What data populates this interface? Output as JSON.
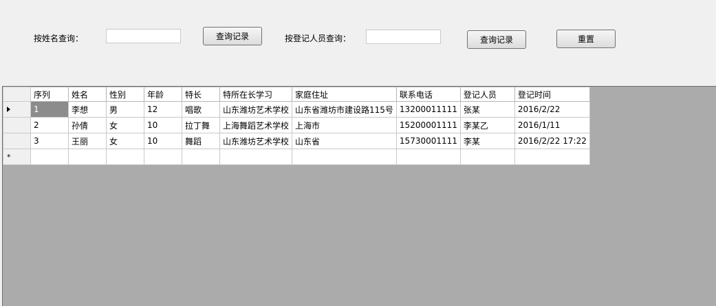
{
  "search": {
    "name_label": "按姓名查询：",
    "name_value": "",
    "name_button": "查询记录",
    "registrar_label": "按登记人员查询：",
    "registrar_value": "",
    "registrar_button": "查询记录",
    "reset_button": "重置"
  },
  "grid": {
    "columns": [
      "序列",
      "姓名",
      "性别",
      "年龄",
      "特长",
      "特所在长学习",
      "家庭住址",
      "联系电话",
      "登记人员",
      "登记时间"
    ],
    "rows": [
      [
        "1",
        "李想",
        "男",
        "12",
        "唱歌",
        "山东潍坊艺术学校",
        "山东省潍坊市建设路115号",
        "13200011111",
        "张某",
        "2016/2/22"
      ],
      [
        "2",
        "孙倩",
        "女",
        "10",
        "拉丁舞",
        "上海舞蹈艺术学校",
        "上海市",
        "15200001111",
        "李某乙",
        "2016/1/11"
      ],
      [
        "3",
        "王丽",
        "女",
        "10",
        "舞蹈",
        "山东潍坊艺术学校",
        "山东省",
        "15730001111",
        "李某",
        "2016/2/22 17:22"
      ]
    ],
    "new_row_marker": "*",
    "current_row_icon": "row-pointer-icon"
  }
}
